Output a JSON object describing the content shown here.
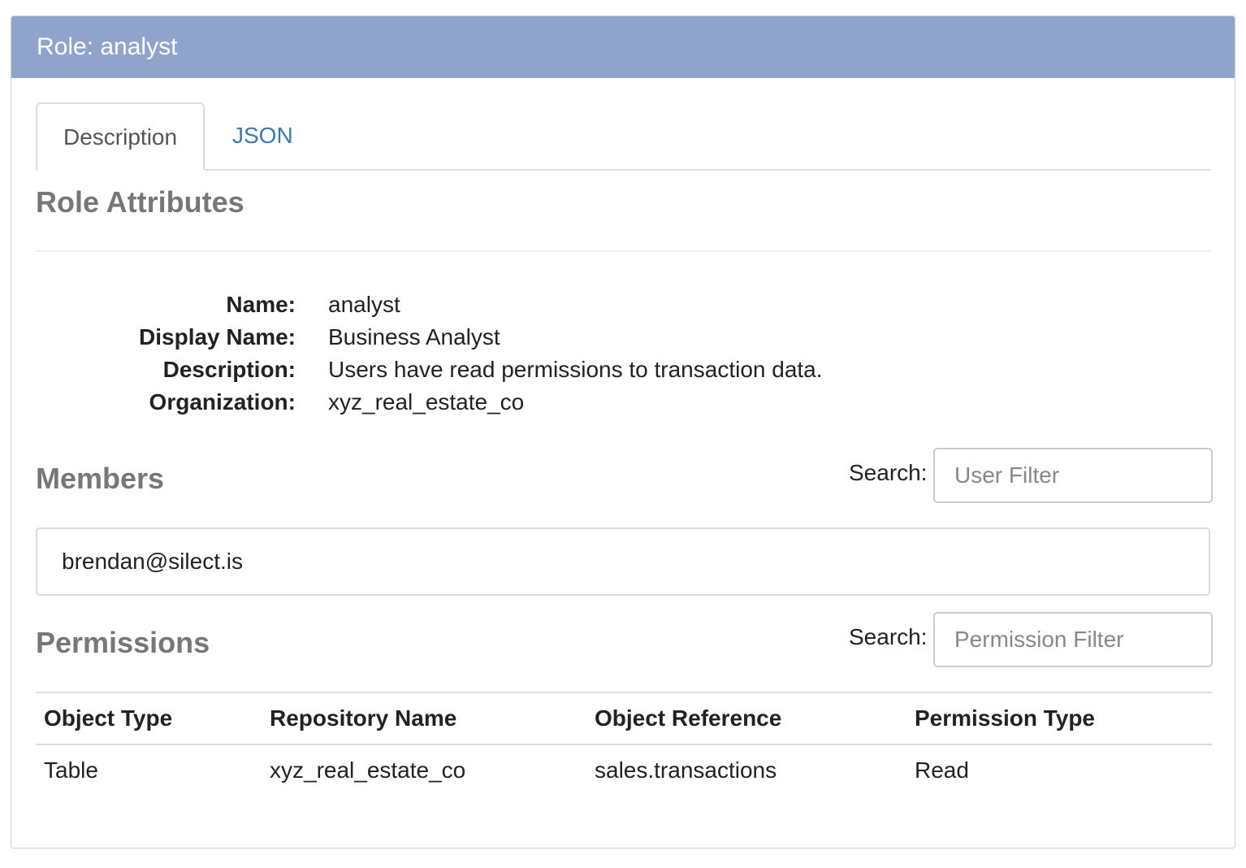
{
  "header": {
    "title": "Role: analyst"
  },
  "tabs": [
    {
      "label": "Description",
      "active": true
    },
    {
      "label": "JSON",
      "active": false
    }
  ],
  "attributes": {
    "title": "Role Attributes",
    "rows": [
      {
        "label": "Name:",
        "value": "analyst"
      },
      {
        "label": "Display Name:",
        "value": "Business Analyst"
      },
      {
        "label": "Description:",
        "value": "Users have read permissions to transaction data."
      },
      {
        "label": "Organization:",
        "value": "xyz_real_estate_co"
      }
    ]
  },
  "members": {
    "title": "Members",
    "search_label": "Search:",
    "search_placeholder": "User Filter",
    "items": [
      "brendan@silect.is"
    ]
  },
  "permissions": {
    "title": "Permissions",
    "search_label": "Search:",
    "search_placeholder": "Permission Filter",
    "columns": [
      "Object Type",
      "Repository Name",
      "Object Reference",
      "Permission Type"
    ],
    "rows": [
      [
        "Table",
        "xyz_real_estate_co",
        "sales.transactions",
        "Read"
      ]
    ]
  },
  "colors": {
    "header_bg": "#8fa3cb",
    "link": "#3a7ab8",
    "section_title": "#777777"
  }
}
